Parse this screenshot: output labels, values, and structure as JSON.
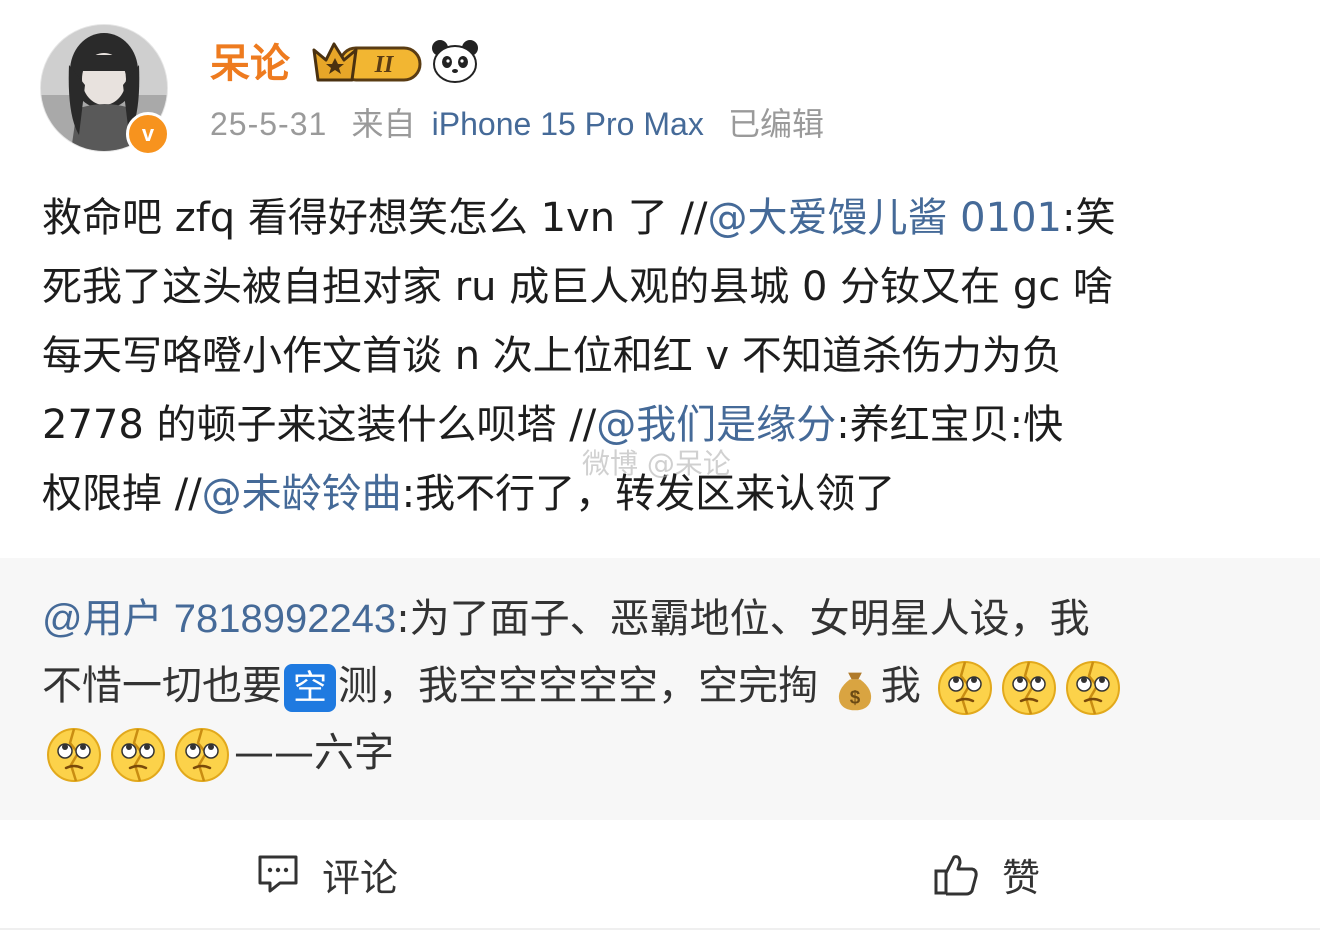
{
  "header": {
    "username": "呆论",
    "level_badge": "II",
    "date": "25-5-31",
    "source_prefix": "来自",
    "device": "iPhone 15 Pro Max",
    "edited": "已编辑"
  },
  "post": {
    "lines": [
      [
        {
          "text": "救命吧 zfq 看得好想笑怎么 1vn 了 //",
          "type": "text"
        },
        {
          "text": "@大爱馒儿酱 0101",
          "type": "mention"
        },
        {
          "text": ":笑",
          "type": "text"
        }
      ],
      [
        {
          "text": "死我了这头被自担对家 ru 成巨人观的县城 0 分钕又在 gc 啥",
          "type": "text"
        }
      ],
      [
        {
          "text": "每天写咯噔小作文首谈 n 次上位和红 v 不知道杀伤力为负",
          "type": "text"
        }
      ],
      [
        {
          "text": " 2778 的顿子来这装什么呗塔 //",
          "type": "text"
        },
        {
          "text": "@我们是缘分",
          "type": "mention"
        },
        {
          "text": ":养红宝贝:快",
          "type": "text"
        }
      ],
      [
        {
          "text": "权限掉 //",
          "type": "text"
        },
        {
          "text": "@未龄铃曲",
          "type": "mention"
        },
        {
          "text": ":我不行了，转发区来认领了",
          "type": "text"
        }
      ]
    ],
    "watermark": "微博 @呆论"
  },
  "quote": {
    "mention": "@用户 7818992243",
    "line1_text": ":为了面子、恶霸地位、女明星人设，我",
    "line2_before": "不惜一切也要",
    "kong_badge": "空",
    "line2_after": "测，我空空空空空，空完掏",
    "line2_end": "我",
    "line3_text": "——六字"
  },
  "footer": {
    "comment_label": "评论",
    "like_label": "赞"
  },
  "colors": {
    "username": "#ee7b1f",
    "mention": "#456a98",
    "meta": "#9a9a9a",
    "verify_badge": "#f7931e",
    "kong_badge": "#1f7ae0",
    "quote_bg": "#f7f7f7"
  },
  "icons": {
    "crown": "crown-level-badge-icon",
    "panda": "panda-icon",
    "money_bag": "money-bag-emoji-icon",
    "eye_roll": "broken-face-emoji-icon",
    "comment": "comment-icon",
    "like": "thumbs-up-icon"
  }
}
